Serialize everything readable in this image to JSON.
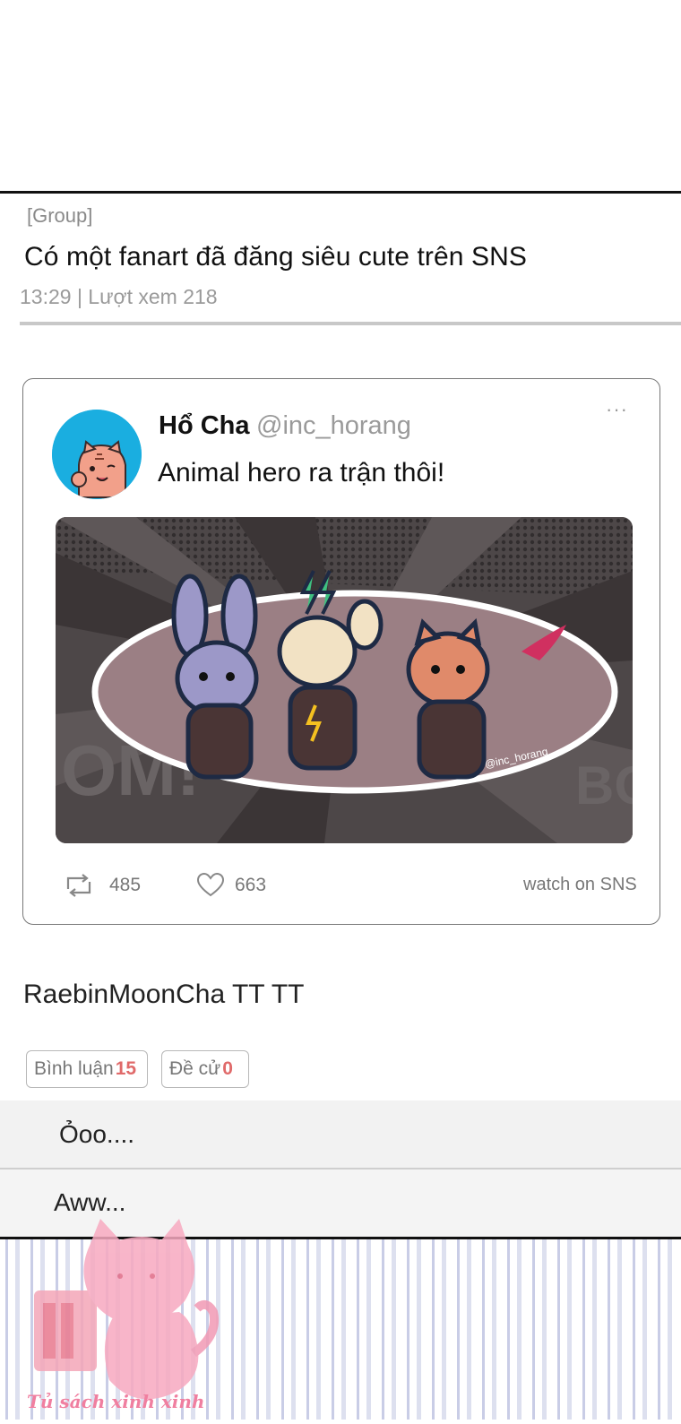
{
  "post": {
    "group_tag": "[Group]",
    "title": "Có một fanart đã đăng siêu cute trên SNS",
    "meta": "13:29 | Lượt xem 218"
  },
  "tweet": {
    "author_name": "Hổ Cha",
    "author_handle": "@inc_horang",
    "more_icon": "more-dots-icon",
    "more_label": "···",
    "text": "Animal hero ra trận thôi!",
    "image_signature": "@inc_horang",
    "retweet_count": "485",
    "like_count": "663",
    "watch_link": "watch on SNS"
  },
  "reply": {
    "text": "RaebinMoonCha TT TT"
  },
  "chips": {
    "comments_label": "Bình luận",
    "comments_count": "15",
    "nominate_label": "Đề cử",
    "nominate_count": "0"
  },
  "comments": [
    {
      "text": "Ỏoo...."
    },
    {
      "text": "Aww..."
    }
  ],
  "watermark": {
    "text": "Tủ sách xinh xinh"
  },
  "colors": {
    "accent_count": "#e06a6a",
    "avatar_bg": "#1aaee0",
    "watermark_pink": "#f07fa0",
    "stripe": "#c9cde6"
  }
}
